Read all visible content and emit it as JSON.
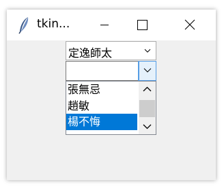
{
  "window": {
    "title": "tkin...",
    "icon": "feather-icon",
    "controls": {
      "minimize": "minimize-icon",
      "maximize": "maximize-icon",
      "close": "close-icon"
    }
  },
  "combobox1": {
    "value": "定逸師太",
    "arrow_icon": "chevron-down-icon"
  },
  "combobox2": {
    "value": "",
    "arrow_icon": "chevron-down-icon"
  },
  "listbox": {
    "items": [
      "張無忌",
      "趙敏",
      "楊不悔"
    ],
    "selected_index": 2,
    "scroll_up_icon": "chevron-up-icon",
    "scroll_down_icon": "chevron-down-icon"
  },
  "colors": {
    "selection": "#0078d7",
    "focus_border": "#569de5",
    "background": "#f0f0f0"
  }
}
